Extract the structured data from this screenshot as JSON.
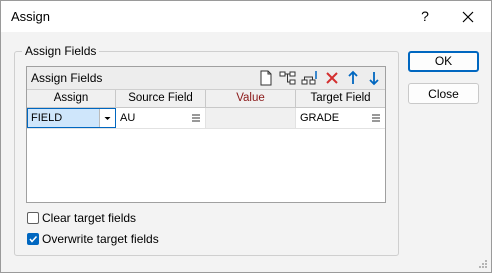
{
  "window": {
    "title": "Assign",
    "help_label": "?"
  },
  "group": {
    "label": "Assign Fields"
  },
  "grid": {
    "title": "Assign Fields",
    "columns": [
      "Assign",
      "Source Field",
      "Value",
      "Target Field"
    ],
    "rows": [
      {
        "assign": "FIELD",
        "source": "AU",
        "value": "",
        "target": "GRADE"
      }
    ]
  },
  "buttons": {
    "ok": "OK",
    "close": "Close"
  },
  "options": {
    "clear_target_fields": {
      "label": "Clear target fields",
      "checked": false
    },
    "overwrite_target_fields": {
      "label": "Overwrite target fields",
      "checked": true
    }
  },
  "colors": {
    "accent": "#0067c0",
    "value_header": "#8b1a1a",
    "delete_icon": "#d32f2f"
  }
}
